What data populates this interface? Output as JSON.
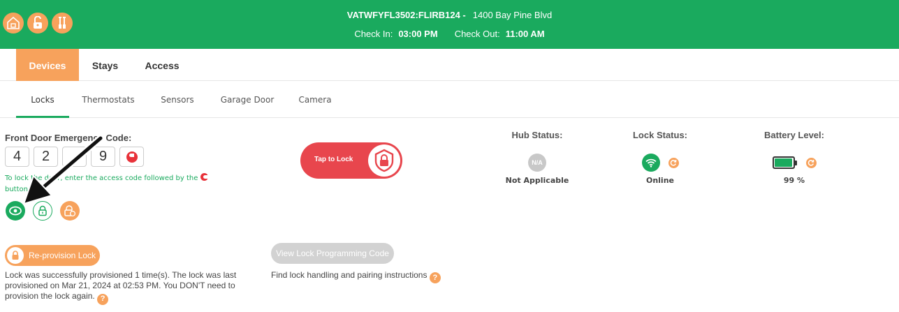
{
  "header": {
    "property_code": "VATWFYFL3502:FLIRB124 -",
    "address": "1400 Bay Pine Blvd",
    "check_in_label": "Check In:",
    "check_in_time": "03:00 PM",
    "check_out_label": "Check Out:",
    "check_out_time": "11:00 AM",
    "icons": [
      "house-icon",
      "unlock-icon",
      "tools-icon"
    ]
  },
  "main_tabs": [
    {
      "label": "Devices",
      "active": true
    },
    {
      "label": "Stays",
      "active": false
    },
    {
      "label": "Access",
      "active": false
    }
  ],
  "sub_tabs": [
    {
      "label": "Locks",
      "active": true
    },
    {
      "label": "Thermostats",
      "active": false
    },
    {
      "label": "Sensors",
      "active": false
    },
    {
      "label": "Garage Door",
      "active": false
    },
    {
      "label": "Camera",
      "active": false
    }
  ],
  "emergency": {
    "title": "Front Door Emergency Code:",
    "digits": [
      "4",
      "2",
      "",
      "9"
    ],
    "hint_part1": "To lock the door, enter the access code followed by the",
    "hint_part2": "button"
  },
  "tap_to_lock": {
    "label": "Tap to Lock"
  },
  "hub_status": {
    "title": "Hub Status:",
    "badge": "N/A",
    "value": "Not Applicable"
  },
  "lock_status": {
    "title": "Lock Status:",
    "value": "Online"
  },
  "battery": {
    "title": "Battery Level:",
    "value": "99 %",
    "level": 0.99
  },
  "reprovision": {
    "button_label": "Re-provision Lock",
    "text": "Lock was successfully provisioned 1 time(s). The lock was last provisioned on Mar 21, 2024 at 02:53 PM. You DON'T need to provision the lock again."
  },
  "programming": {
    "button_label": "View Lock Programming Code",
    "find_text": "Find lock handling and pairing instructions"
  },
  "help_glyph": "?",
  "colors": {
    "header_green": "#1aaa5e",
    "accent_orange": "#f7a25c",
    "lock_red": "#e8464d",
    "disabled_gray": "#d2d2d2"
  }
}
